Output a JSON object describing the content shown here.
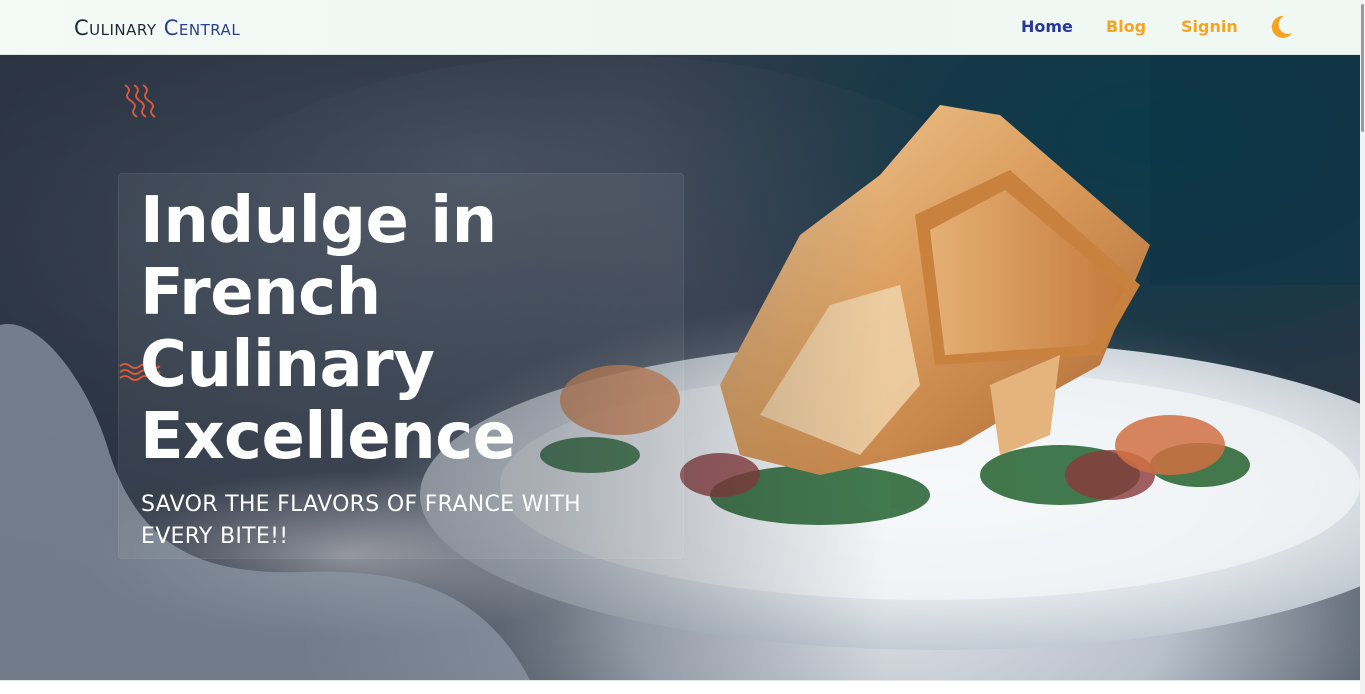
{
  "navbar": {
    "brand_part1": "Culinary",
    "brand_part2": "Central",
    "links": [
      {
        "label": "Home"
      },
      {
        "label": "Blog"
      },
      {
        "label": "Signin"
      }
    ],
    "theme_toggle_icon": "moon-icon"
  },
  "hero": {
    "title": "Indulge in French Culinary Excellence",
    "subtitle": "SAVOR THE FLAVORS OF FRANCE WITH EVERY BITE!!",
    "decorations": [
      "squiggle-icon",
      "wave-lines-icon"
    ]
  },
  "colors": {
    "brand_dark": "#1f2933",
    "brand_blue": "#2b3f8f",
    "nav_active": "#26389a",
    "nav_accent": "#f5a422",
    "decor_red": "#e05a3a"
  }
}
